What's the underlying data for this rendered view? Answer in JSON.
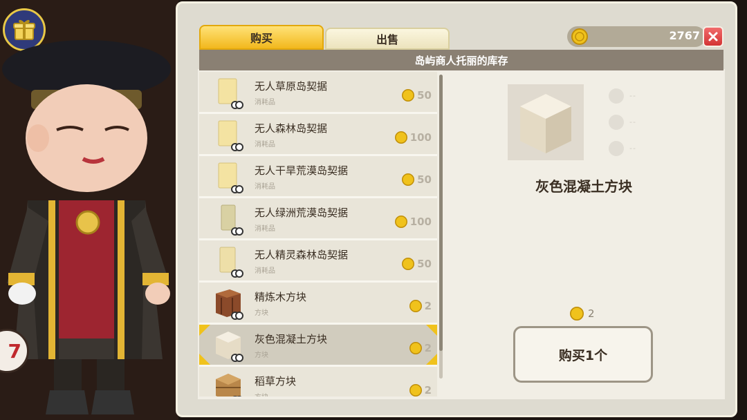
{
  "tabs": {
    "buy": "购买",
    "sell": "出售"
  },
  "currency": {
    "amount": "2767",
    "icon": "coin-icon"
  },
  "shop_title": "岛屿商人托丽的库存",
  "items": [
    {
      "name": "无人草原岛契据",
      "category": "消耗品",
      "price": "50",
      "icon": "deed-icon"
    },
    {
      "name": "无人森林岛契据",
      "category": "消耗品",
      "price": "100",
      "icon": "deed-icon"
    },
    {
      "name": "无人干旱荒漠岛契据",
      "category": "消耗品",
      "price": "50",
      "icon": "deed-icon"
    },
    {
      "name": "无人绿洲荒漠岛契据",
      "category": "消耗品",
      "price": "100",
      "icon": "deed-icon"
    },
    {
      "name": "无人精灵森林岛契据",
      "category": "消耗品",
      "price": "50",
      "icon": "deed-icon"
    },
    {
      "name": "精炼木方块",
      "category": "方块",
      "price": "2",
      "icon": "wood-block-icon"
    },
    {
      "name": "灰色混凝土方块",
      "category": "方块",
      "price": "2",
      "icon": "concrete-block-icon"
    },
    {
      "name": "稻草方块",
      "category": "方块",
      "price": "2",
      "icon": "straw-block-icon"
    }
  ],
  "selected_index": 6,
  "detail": {
    "name": "灰色混凝土方块",
    "price": "2",
    "slot_placeholder": "--",
    "buy_label": "购买1个"
  },
  "badge": {
    "text": "7"
  },
  "colors": {
    "accent": "#f2b81d",
    "close": "#d33434",
    "coin": "#f0c21c"
  }
}
